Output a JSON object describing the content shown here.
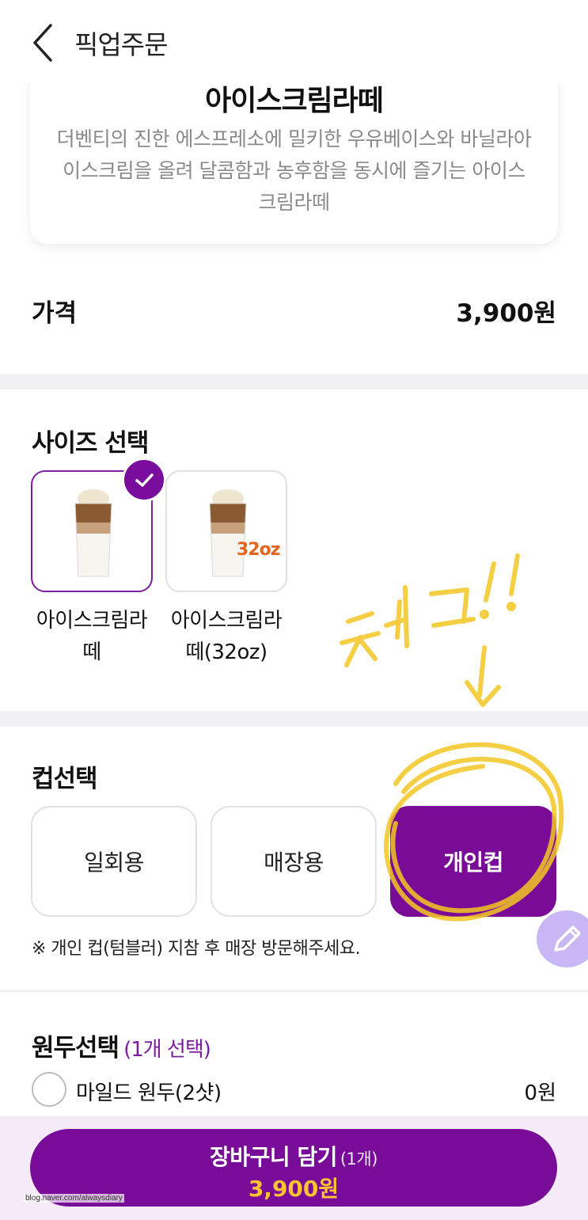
{
  "header": {
    "title": "픽업주문",
    "back_icon": "chevron-left-icon"
  },
  "product": {
    "name": "아이스크림라떼",
    "description": "더벤티의 진한 에스프레소에 밀키한 우유베이스와 바닐라아이스크림을 올려 달콤함과 농후함을 동시에 즐기는 아이스크림라떼"
  },
  "price": {
    "label": "가격",
    "value": "3,900원"
  },
  "size_section": {
    "title": "사이즈 선택",
    "options": [
      {
        "label": "아이스크림라떼",
        "selected": true
      },
      {
        "label": "아이스크림라떼(32oz)",
        "badge": "32oz",
        "selected": false
      }
    ]
  },
  "cup_section": {
    "title": "컵선택",
    "options": [
      {
        "label": "일회용",
        "selected": false
      },
      {
        "label": "매장용",
        "selected": false
      },
      {
        "label": "개인컵",
        "selected": true
      }
    ],
    "note": "※ 개인 컵(텀블러) 지참 후 매장 방문해주세요."
  },
  "bean_section": {
    "title": "원두선택",
    "subtitle": "(1개 선택)",
    "options": [
      {
        "label": "마일드 원두(2샷)",
        "price": "0원"
      }
    ]
  },
  "cart": {
    "label": "장바구니 담기",
    "qty": "(1개)",
    "price": "3,900원"
  },
  "annotation_text": "체크 !!",
  "watermark": "blog.naver.com/alwaysdiary",
  "colors": {
    "brand_purple": "#7a0b96",
    "price_yellow": "#ffc431",
    "highlight": "#f3c623"
  }
}
